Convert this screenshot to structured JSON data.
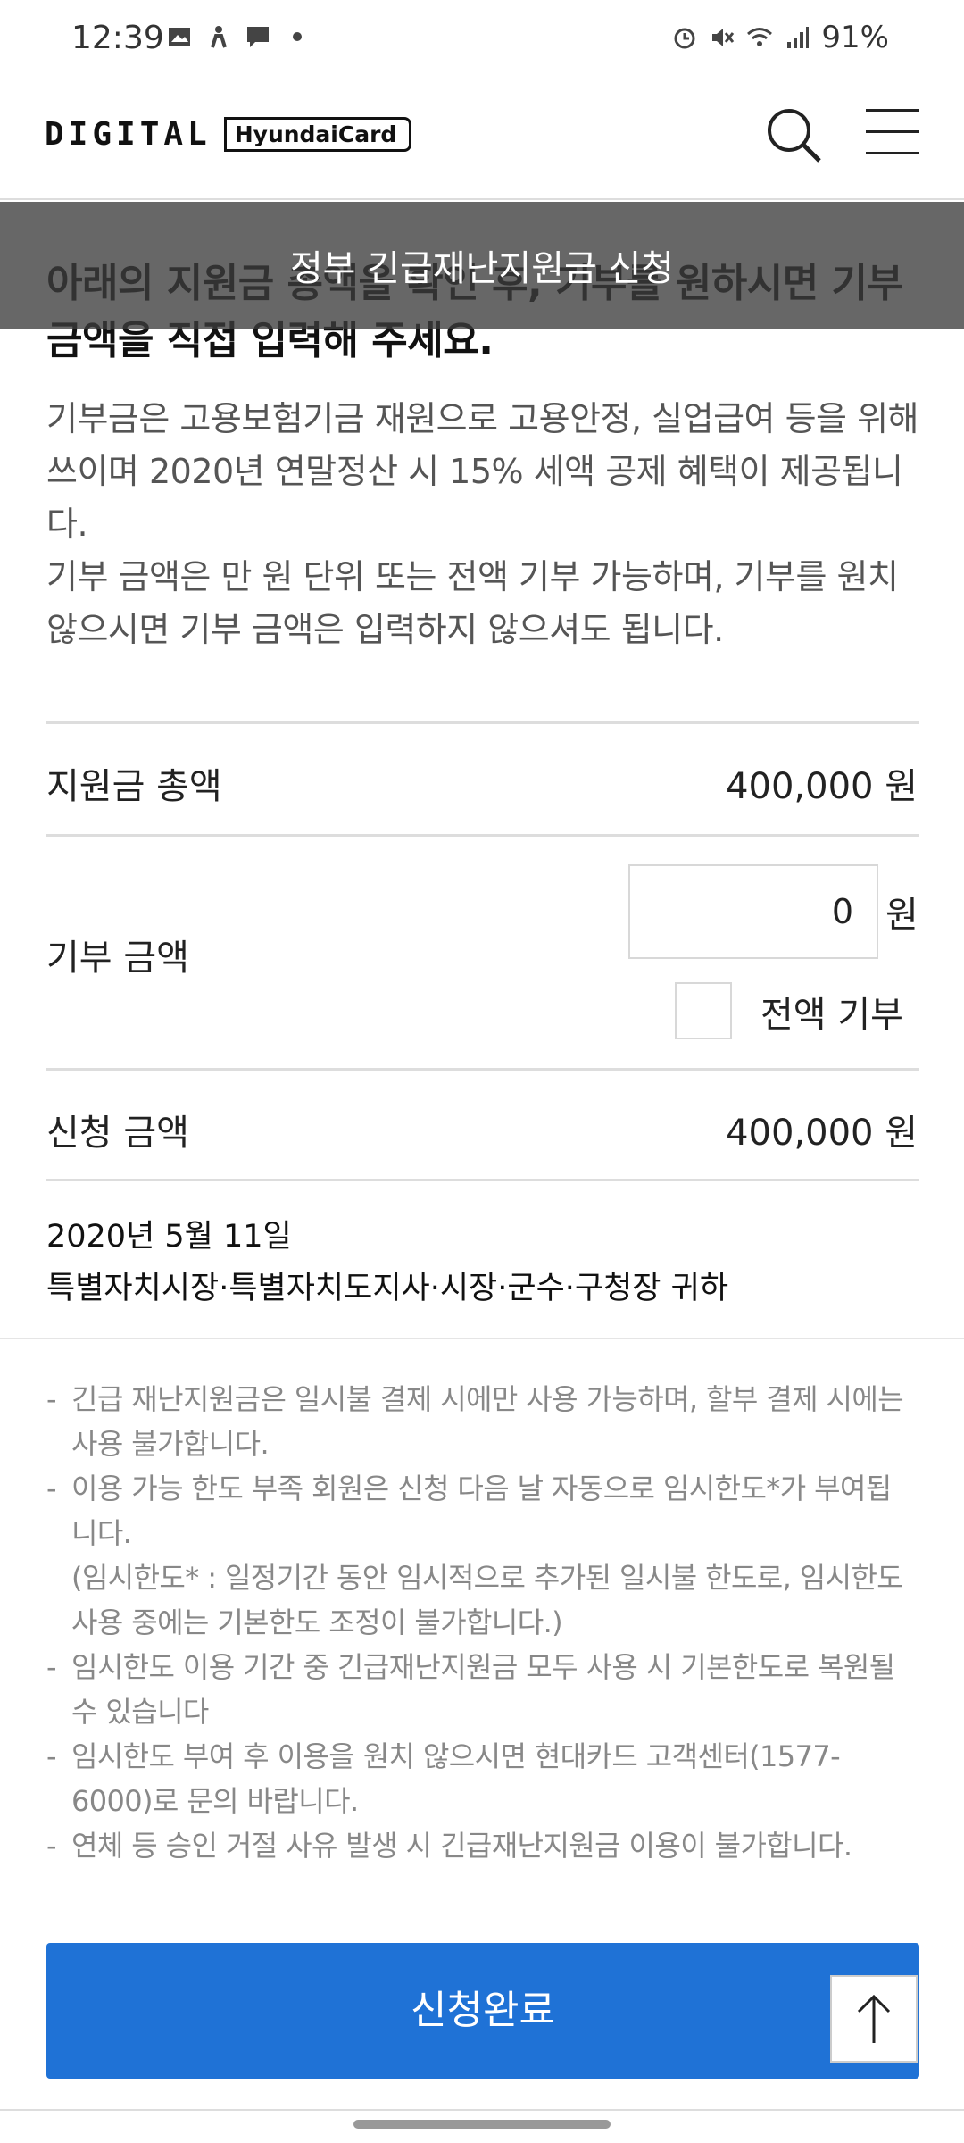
{
  "status_bar": {
    "time": "12:39",
    "battery": "91%"
  },
  "header": {
    "logo_digital": "DIGITAL",
    "logo_brand": "HyundaiCard"
  },
  "page_title": "정부 긴급재난지원금 신청",
  "headline": "아래의 지원금 총액을 확인 후, 기부를 원하시면 기부 금액을 직접 입력해 주세요.",
  "description": [
    "기부금은 고용보험기금 재원으로 고용안정, 실업급여 등을 위해 쓰이며 2020년 연말정산 시 15% 세액 공제 혜택이 제공됩니다.",
    "기부 금액은 만 원 단위 또는 전액 기부 가능하며, 기부를 원치 않으시면 기부 금액은 입력하지 않으셔도 됩니다."
  ],
  "rows": {
    "total": {
      "label": "지원금 총액",
      "value": "400,000 원"
    },
    "donation": {
      "label": "기부 금액",
      "input_value": "0",
      "unit": "원",
      "full_donation_label": "전액 기부",
      "full_donation_checked": false
    },
    "apply": {
      "label": "신청 금액",
      "value": "400,000 원"
    }
  },
  "date": "2020년 5월 11일",
  "addressee": "특별자치시장·특별자치도지사·시장·군수·구청장 귀하",
  "notes": [
    "긴급 재난지원금은 일시불 결제 시에만 사용 가능하며, 할부 결제 시에는 사용 불가합니다.",
    "이용 가능 한도 부족 회원은 신청 다음 날 자동으로 임시한도*가 부여됩니다.",
    "(임시한도* : 일정기간 동안 임시적으로 추가된 일시불 한도로, 임시한도 사용 중에는 기본한도 조정이 불가합니다.)",
    "임시한도 이용 기간 중 긴급재난지원금 모두 사용 시 기본한도로 복원될 수 있습니다",
    "임시한도 부여 후 이용을 원치 않으시면 현대카드 고객센터(1577-6000)로 문의 바랍니다.",
    "연체 등 승인 거절 사유 발생 시 긴급재난지원금 이용이 불가합니다."
  ],
  "submit_label": "신청완료",
  "colors": {
    "accent": "#1f72d6",
    "overlay": "#3c3c3c"
  }
}
